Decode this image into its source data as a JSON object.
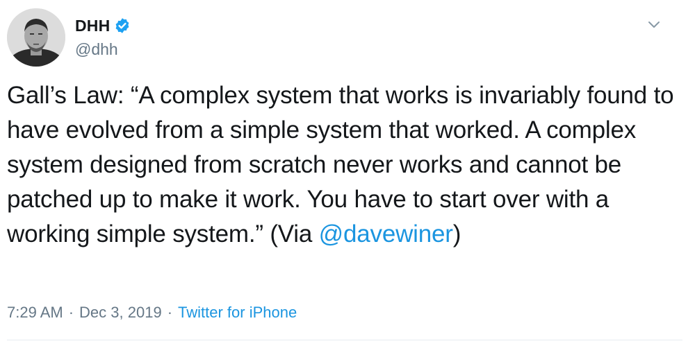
{
  "author": {
    "display_name": "DHH",
    "username": "@dhh",
    "verified": true
  },
  "tweet": {
    "text_before_mention": "Gall’s Law: “A complex system that works is invariably found to have evolved from a simple system that worked. A complex system designed from scratch never works and cannot be patched up to make it work. You have to start over with a working simple system.” (Via ",
    "mention": "@davewiner",
    "text_after_mention": ")"
  },
  "meta": {
    "time": "7:29 AM",
    "separator": "·",
    "date": "Dec 3, 2019",
    "source": "Twitter for iPhone"
  },
  "icons": {
    "verified": "verified-badge-icon",
    "caret": "chevron-down-icon"
  },
  "colors": {
    "link": "#1b95e0",
    "verified": "#1da1f2",
    "secondary_text": "#657786",
    "primary_text": "#14171a"
  }
}
